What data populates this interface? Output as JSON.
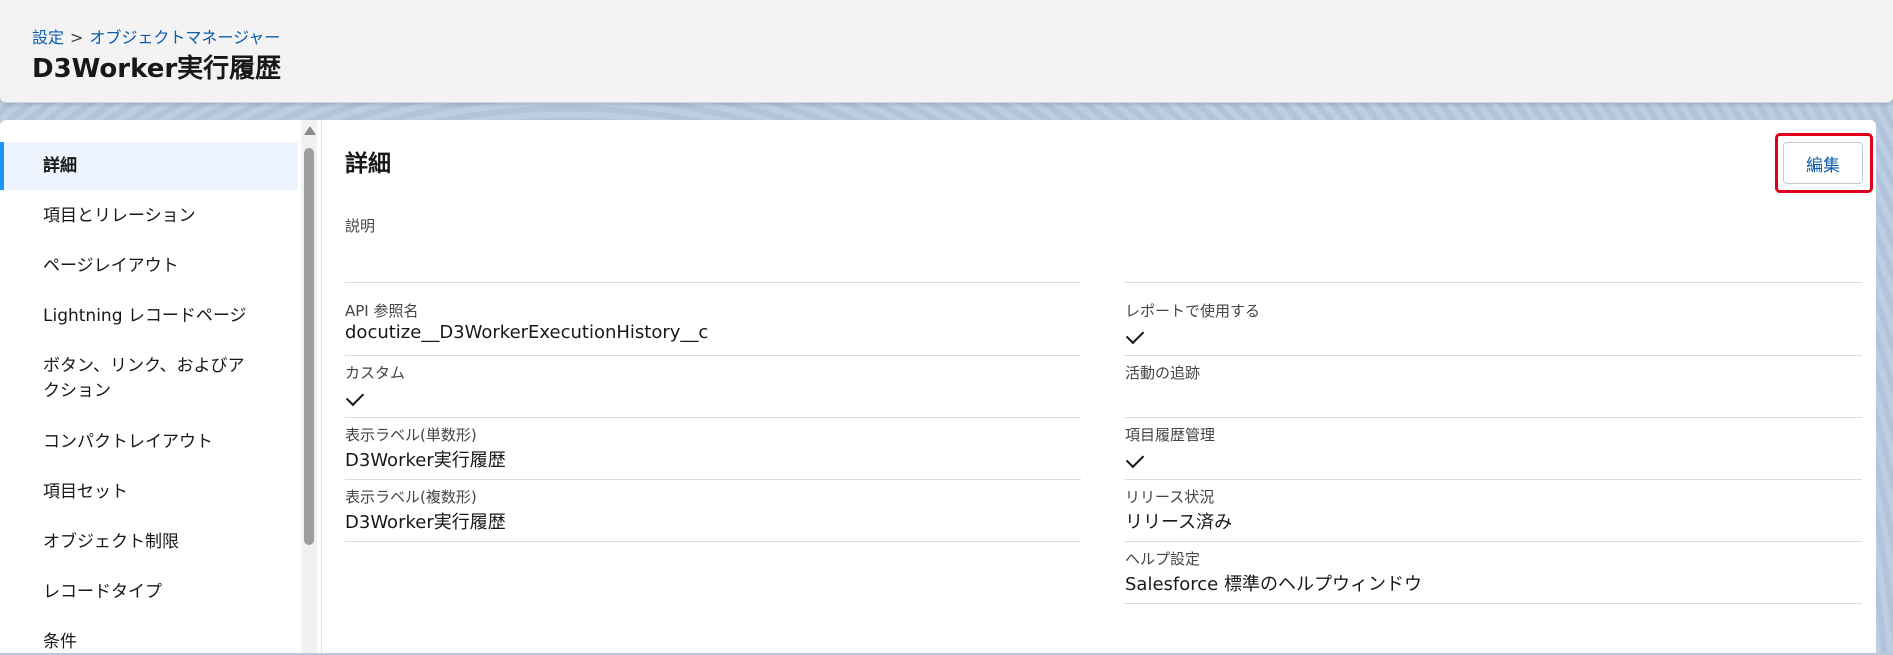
{
  "breadcrumb": {
    "setup": "設定",
    "separator": ">",
    "object_manager": "オブジェクトマネージャー"
  },
  "page_title": "D3Worker実行履歴",
  "sidebar": {
    "items": [
      {
        "label": "詳細",
        "active": true
      },
      {
        "label": "項目とリレーション"
      },
      {
        "label": "ページレイアウト"
      },
      {
        "label": "Lightning レコードページ"
      },
      {
        "label": "ボタン、リンク、およびア"
      },
      {
        "label": "クション"
      },
      {
        "label": "コンパクトレイアウト"
      },
      {
        "label": "項目セット"
      },
      {
        "label": "オブジェクト制限"
      },
      {
        "label": "レコードタイプ"
      },
      {
        "label": "条件"
      }
    ]
  },
  "details": {
    "title": "詳細",
    "edit_label": "編集",
    "description_label": "説明",
    "description_value": "",
    "left": [
      {
        "label": "API 参照名",
        "value": "docutize__D3WorkerExecutionHistory__c"
      },
      {
        "label": "カスタム",
        "checked": true
      },
      {
        "label": "表示ラベル(単数形)",
        "value": "D3Worker実行履歴"
      },
      {
        "label": "表示ラベル(複数形)",
        "value": "D3Worker実行履歴"
      }
    ],
    "right": [
      {
        "label": "レポートで使用する",
        "checked": true
      },
      {
        "label": "活動の追跡",
        "checked": false
      },
      {
        "label": "項目履歴管理",
        "checked": true
      },
      {
        "label": "リリース状況",
        "value": "リリース済み"
      },
      {
        "label": "ヘルプ設定",
        "value": "Salesforce 標準のヘルプウィンドウ"
      }
    ]
  },
  "colors": {
    "accent": "#1b96ff",
    "link": "#0b5cab",
    "highlight": "#e0001a"
  }
}
